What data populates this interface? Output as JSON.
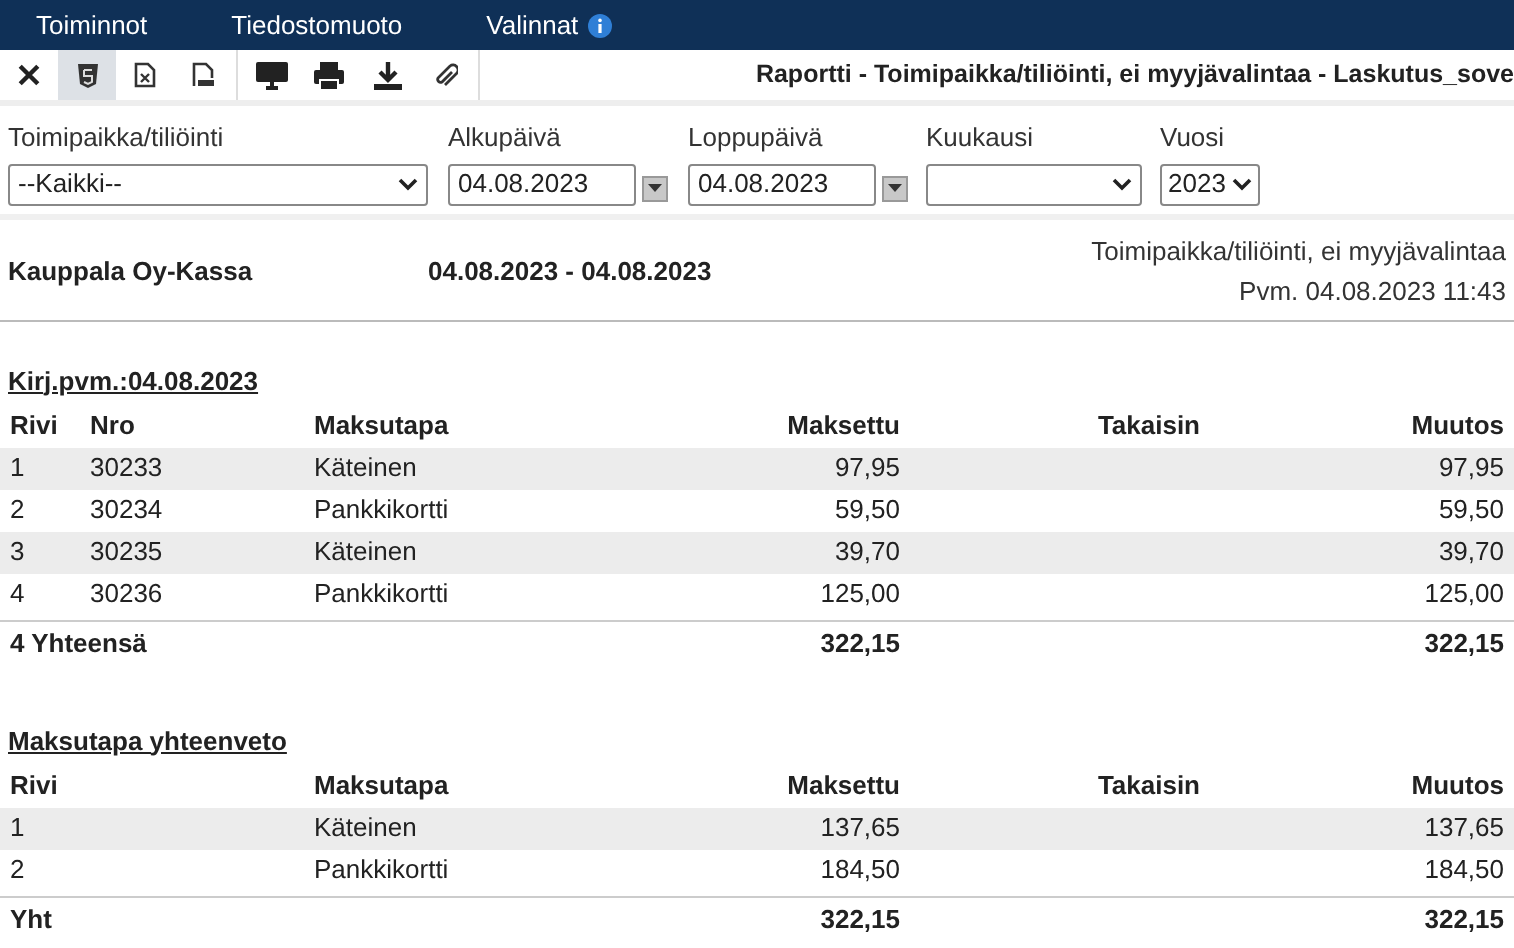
{
  "menu": [
    {
      "label": "Toiminnot",
      "info": false
    },
    {
      "label": "Tiedostomuoto",
      "info": false
    },
    {
      "label": "Valinnat",
      "info": true
    }
  ],
  "toolbar": [
    {
      "kind": "close",
      "selected": false
    },
    {
      "kind": "html",
      "selected": true
    },
    {
      "kind": "excel",
      "selected": false
    },
    {
      "kind": "pdf",
      "selected": false
    },
    {
      "kind": "screen",
      "selected": false
    },
    {
      "kind": "print",
      "selected": false
    },
    {
      "kind": "download",
      "selected": false
    },
    {
      "kind": "attach",
      "selected": false
    }
  ],
  "title": "Raportti - Toimipaikka/tiliöinti, ei myyjävalintaa - Laskutus_sove",
  "filters": [
    {
      "label": "Toimipaikka/tiliöinti",
      "kind": "select",
      "value": "--Kaikki--"
    },
    {
      "label": "Alkupäivä",
      "kind": "date",
      "value": "04.08.2023"
    },
    {
      "label": "Loppupäivä",
      "kind": "date",
      "value": "04.08.2023"
    },
    {
      "label": "Kuukausi",
      "kind": "select"
    },
    {
      "label": "Vuosi",
      "kind": "year",
      "value": "2023"
    }
  ],
  "report": {
    "company": "Kauppala Oy-Kassa",
    "start": "04.08.2023",
    "dash": "-",
    "end": "04.08.2023",
    "subtitle": "Toimipaikka/tiliöinti, ei myyjävalintaa",
    "printed": "Pvm. 04.08.2023 11:43"
  },
  "sections": [
    {
      "heading": "Kirj.pvm.:04.08.2023",
      "columns": [
        "Rivi",
        "Nro",
        "Maksutapa",
        "Maksettu",
        "Takaisin",
        "Muutos"
      ],
      "rows": [
        [
          "1",
          "30233",
          "Käteinen",
          "97,95",
          null,
          "97,95"
        ],
        [
          "2",
          "30234",
          "Pankkikortti",
          "59,50",
          null,
          "59,50"
        ],
        [
          "3",
          "30235",
          "Käteinen",
          "39,70",
          null,
          "39,70"
        ],
        [
          "4",
          "30236",
          "Pankkikortti",
          "125,00",
          null,
          "125,00"
        ]
      ],
      "total": {
        "label": "4 Yhteensä",
        "paid": "322,15",
        "change": "322,15"
      }
    },
    {
      "heading": "Maksutapa yhteenveto",
      "columns": [
        "Rivi",
        null,
        "Maksutapa",
        "Maksettu",
        "Takaisin",
        "Muutos"
      ],
      "rows": [
        [
          "1",
          null,
          "Käteinen",
          "137,65",
          null,
          "137,65"
        ],
        [
          "2",
          null,
          "Pankkikortti",
          "184,50",
          null,
          "184,50"
        ]
      ],
      "total": {
        "label": "Yht",
        "paid": "322,15",
        "change": "322,15"
      }
    }
  ]
}
